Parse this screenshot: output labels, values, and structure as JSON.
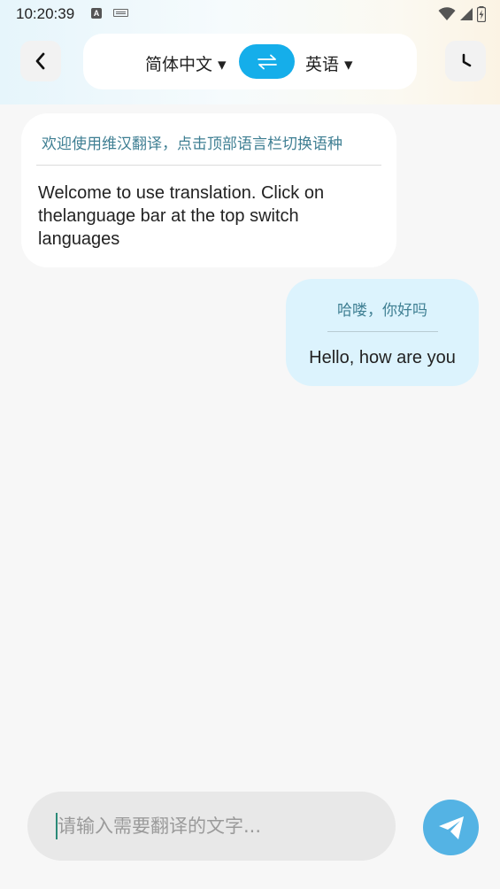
{
  "status_bar": {
    "time": "10:20:39",
    "icons": [
      "a-app-icon",
      "keyboard-icon",
      "wifi-icon",
      "signal-icon",
      "battery-charging-icon"
    ]
  },
  "header": {
    "back_icon": "chevron-left-icon",
    "source_language": "简体中文 ▾",
    "target_language": "英语 ▾",
    "swap_icon": "swap-arrows-icon",
    "history_icon": "clock-icon"
  },
  "messages": [
    {
      "side": "left",
      "source_text": "欢迎使用维汉翻译，点击顶部语言栏切换语种",
      "translated_text": "Welcome to use translation. Click on thelanguage bar at the top switch languages"
    },
    {
      "side": "right",
      "source_text": "哈喽，你好吗",
      "translated_text": "Hello, how are you"
    }
  ],
  "input": {
    "value": "",
    "placeholder": "请输入需要翻译的文字..."
  },
  "send": {
    "icon": "paper-plane-send-icon"
  },
  "colors": {
    "accent": "#15aeea",
    "send_button": "#54b3e4",
    "user_bubble": "#dcf3fd",
    "source_text": "#3f7f93"
  }
}
